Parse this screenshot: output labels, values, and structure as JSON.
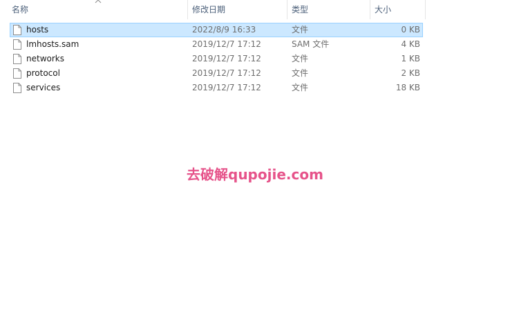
{
  "columns": {
    "name": "名称",
    "date": "修改日期",
    "type": "类型",
    "size": "大小"
  },
  "files": [
    {
      "name": "hosts",
      "date": "2022/8/9 16:33",
      "type": "文件",
      "size": "0 KB",
      "selected": true
    },
    {
      "name": "lmhosts.sam",
      "date": "2019/12/7 17:12",
      "type": "SAM 文件",
      "size": "4 KB",
      "selected": false
    },
    {
      "name": "networks",
      "date": "2019/12/7 17:12",
      "type": "文件",
      "size": "1 KB",
      "selected": false
    },
    {
      "name": "protocol",
      "date": "2019/12/7 17:12",
      "type": "文件",
      "size": "2 KB",
      "selected": false
    },
    {
      "name": "services",
      "date": "2019/12/7 17:12",
      "type": "文件",
      "size": "18 KB",
      "selected": false
    }
  ],
  "watermark": "去破解qupojie.com",
  "colors": {
    "selection_bg": "#cce8ff",
    "selection_border": "#99d1ff",
    "header_text": "#4c607a",
    "watermark": "#e6538a"
  },
  "icons": {
    "sort": "chevron-up-icon",
    "file": "file-icon"
  }
}
